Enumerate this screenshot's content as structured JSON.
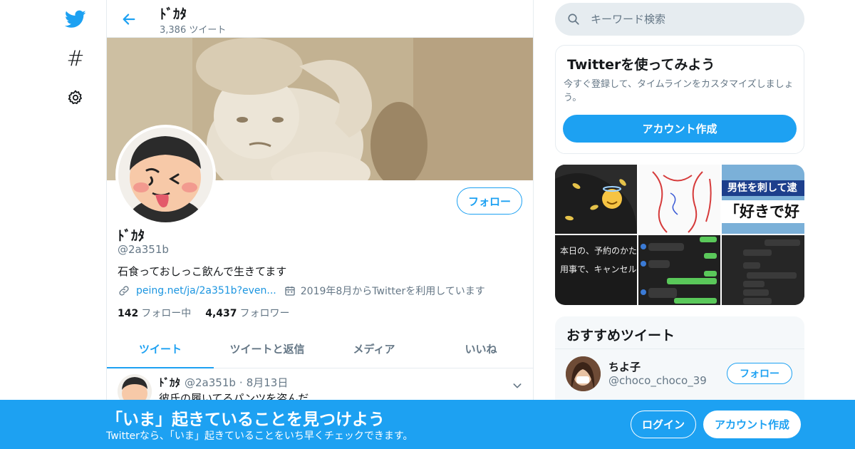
{
  "colors": {
    "accent": "#1da1f2",
    "text": "#14171a",
    "muted": "#657786",
    "border": "#e6ecf0"
  },
  "nav": {
    "items": [
      {
        "name": "twitter-logo-icon"
      },
      {
        "name": "hashtag-icon",
        "glyph": "#"
      },
      {
        "name": "settings-gear-icon"
      }
    ]
  },
  "header": {
    "name": "ﾄﾞｶﾀ",
    "tweet_count": "3,386 ツイート"
  },
  "profile": {
    "follow_label": "フォロー",
    "name": "ﾄﾞｶﾀ",
    "handle": "@2a351b",
    "bio": "石食っておしっこ飲んで生きてます",
    "link": "peing.net/ja/2a351b?even...",
    "joined": "2019年8月からTwitterを利用しています",
    "following_count": "142",
    "following_label": "フォロー中",
    "followers_count": "4,437",
    "followers_label": "フォロワー"
  },
  "tabs": [
    "ツイート",
    "ツイートと返信",
    "メディア",
    "いいね"
  ],
  "tweet": {
    "name": "ﾄﾞｶﾀ",
    "handle": "@2a351b",
    "dot": "·",
    "date": "8月13日",
    "text": "彼氏の履いてるパンツを盗んだ"
  },
  "search": {
    "placeholder": "キーワード検索"
  },
  "signup_card": {
    "title": "Twitterを使ってみよう",
    "description": "今すぐ登録して、タイムラインをカスタマイズしましょう。",
    "button": "アカウント作成"
  },
  "media": {
    "tile_news_line1": "男性を刺して逮",
    "tile_news_line2": "「好きで好",
    "tile_text_line1": "本日の、予約のかた、",
    "tile_text_line2": "用事で、キャンセルに"
  },
  "recommended": {
    "title": "おすすめツイート",
    "user_name": "ちよ子",
    "user_handle": "@choco_choco_39",
    "follow_label": "フォロー"
  },
  "bottom_bar": {
    "title": "「いま」起きていることを見つけよう",
    "subtitle": "Twitterなら、「いま」起きていることをいち早くチェックできます。",
    "login": "ログイン",
    "signup": "アカウント作成"
  }
}
